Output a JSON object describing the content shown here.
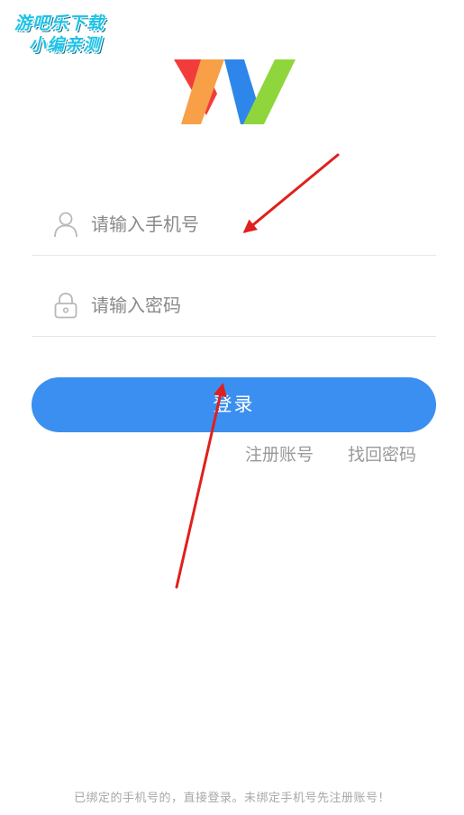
{
  "watermark": {
    "line1": "游吧乐下载",
    "line2": "小编亲测"
  },
  "logo": {
    "name": "app-logo",
    "colors": [
      "#f23c3c",
      "#f7a048",
      "#2f86ea",
      "#8fd63c"
    ]
  },
  "form": {
    "phone": {
      "placeholder": "请输入手机号",
      "value": "",
      "icon": "user-icon"
    },
    "password": {
      "placeholder": "请输入密码",
      "value": "",
      "icon": "lock-icon"
    },
    "login_label": "登录"
  },
  "links": {
    "register": "注册账号",
    "forgot": "找回密码"
  },
  "footer": {
    "note": "已绑定的手机号的，直接登录。未绑定手机号先注册账号！"
  },
  "colors": {
    "accent": "#3a8ff0",
    "annotation_arrow": "#e0201c",
    "placeholder": "#8a8a8a",
    "divider": "#e6e6e6"
  }
}
